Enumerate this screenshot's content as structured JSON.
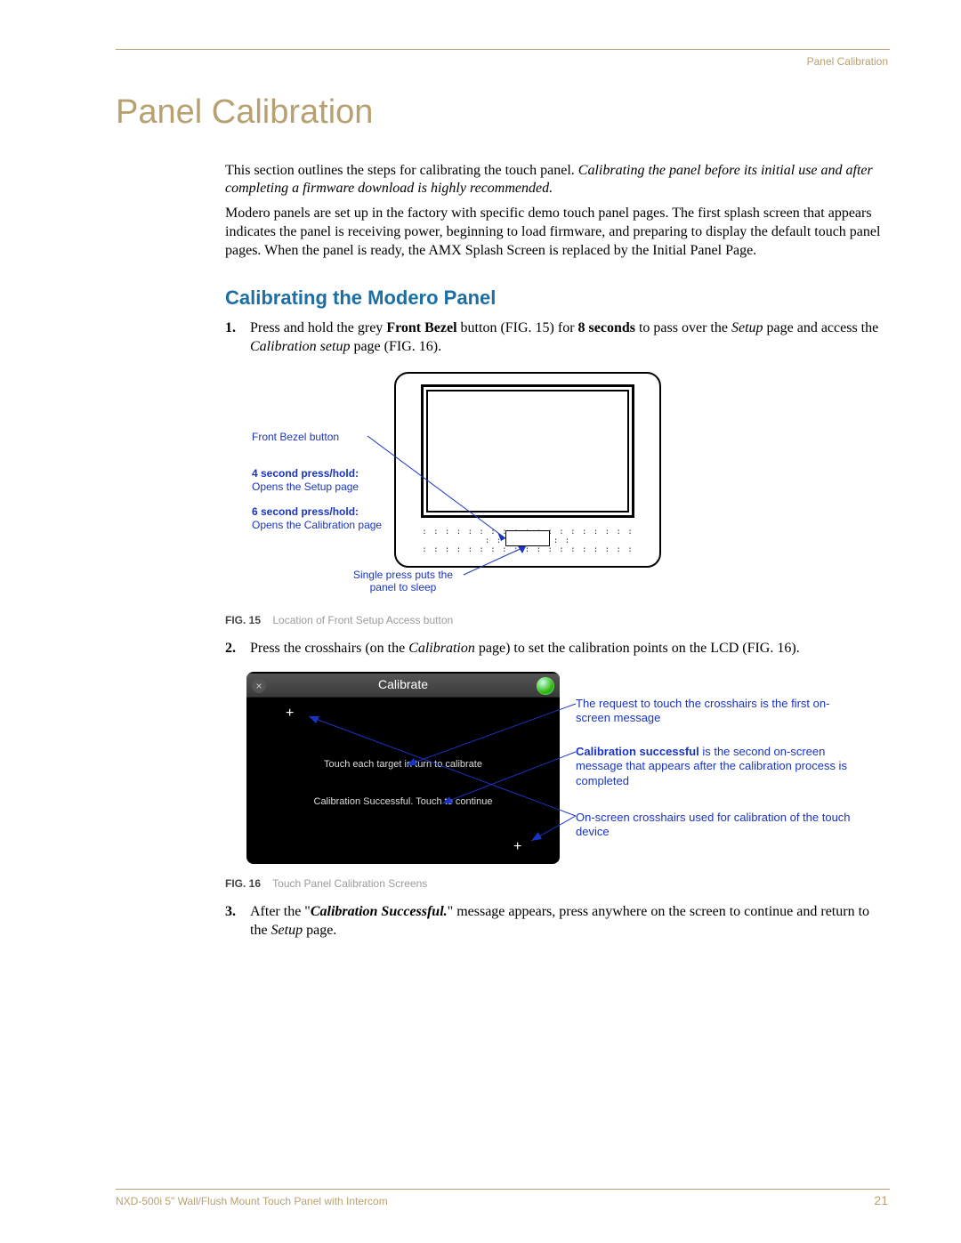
{
  "header": {
    "section": "Panel Calibration"
  },
  "page_title": "Panel Calibration",
  "intro_para1_pre": "This section outlines the steps for calibrating the touch panel. ",
  "intro_para1_em": "Calibrating the panel before its initial use and after completing a firmware download is highly recommended.",
  "intro_para2": "Modero panels are set up in the factory with specific demo touch panel pages. The first splash screen that appears indicates the panel is receiving power, beginning to load firmware, and preparing to display the default touch panel pages. When the panel is ready, the AMX Splash Screen is replaced by the Initial Panel Page.",
  "subheading": "Calibrating the Modero Panel",
  "steps": {
    "s1": {
      "num": "1.",
      "t1": "Press and hold the grey ",
      "bold1": "Front Bezel",
      "t2": " button (FIG. 15) for ",
      "bold2": "8 seconds",
      "t3": " to pass over the ",
      "em1": "Setup",
      "t4": " page and access the ",
      "em2": "Calibration setup",
      "t5": " page (FIG. 16)."
    },
    "s2": {
      "num": "2.",
      "t1": "Press the crosshairs (on the ",
      "em1": "Calibration",
      "t2": " page) to set the calibration points on the LCD (FIG. 16)."
    },
    "s3": {
      "num": "3.",
      "t1": "After the \"",
      "boldem1": "Calibration Successful.",
      "t2": "\" message appears, press anywhere on the screen to continue and return to the ",
      "em1": "Setup",
      "t3": " page."
    }
  },
  "fig15": {
    "label_frontbezel": "Front Bezel button",
    "label_4s_bold": "4 second press/hold:",
    "label_4s_text": "Opens the Setup page",
    "label_6s_bold": "6 second press/hold:",
    "label_6s_text": "Opens the Calibration page",
    "label_singlepress": "Single press puts the panel to sleep",
    "caption_no": "FIG. 15",
    "caption_text": "Location of Front Setup Access button"
  },
  "fig16": {
    "screen": {
      "title": "Calibrate",
      "close": "×",
      "cross": "+",
      "msg1": "Touch each target in turn to calibrate",
      "msg2": "Calibration Successful. Touch to continue"
    },
    "annot1": "The request to touch the crosshairs is the first on-screen message",
    "annot2_bold": "Calibration successful",
    "annot2_rest": " is the second on-screen message that appears after the calibration process is completed",
    "annot3": "On-screen crosshairs used for calibration of the touch device",
    "caption_no": "FIG. 16",
    "caption_text": "Touch Panel Calibration Screens"
  },
  "footer": {
    "product": "NXD-500i 5\" Wall/Flush Mount Touch Panel with Intercom",
    "page": "21"
  }
}
